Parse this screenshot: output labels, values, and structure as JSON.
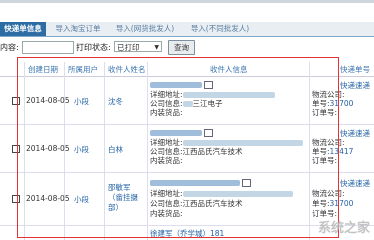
{
  "tabs": [
    {
      "label": "快递单信息",
      "active": true
    },
    {
      "label": "导入淘宝订单",
      "active": false
    },
    {
      "label": "导入(网货批发人)",
      "active": false
    },
    {
      "label": "导入(不同批发人)",
      "active": false
    }
  ],
  "filter": {
    "content_label": "内容:",
    "print_status_label": "打印状态:",
    "print_status_value": "已打印",
    "query_button": "查询"
  },
  "table": {
    "headers": [
      "创建日期",
      "所属用户",
      "收件人姓名",
      "收件人信息",
      "快递单号"
    ],
    "rows": [
      {
        "date": "2014-08-05",
        "user": "小段",
        "name": "沈冬",
        "address_label": "详细地址:",
        "company_label": "公司信息:",
        "company": "三江电子",
        "goods_label": "内装货品:",
        "express_lines": [
          "快递速递",
          "物流公司:",
          "单号:",
          "订单号:"
        ],
        "express_number": "31700"
      },
      {
        "date": "2014-08-05",
        "user": "小段",
        "name": "白林",
        "address_label": "详细地址:",
        "company_label": "公司信息:",
        "company": "江西品氏汽车技术",
        "goods_label": "内装货品:",
        "express_lines": [
          "快递速递",
          "物流公司:",
          "单号:",
          "订单号:"
        ],
        "express_number": "13417"
      },
      {
        "date": "2014-08-05",
        "user": "小段",
        "name": "邵敏军（畲挂摄部）",
        "address_label": "详细地址:",
        "company_label": "公司信息:",
        "company": "江西品氏汽车技术",
        "goods_label": "内装货品:",
        "express_lines": [
          "快递速递",
          "物流公司:",
          "单号:",
          "订单号:"
        ],
        "express_number": "31700"
      }
    ],
    "partial_row_text": "徐建军（乔学城）181"
  },
  "watermark": "系统之家"
}
